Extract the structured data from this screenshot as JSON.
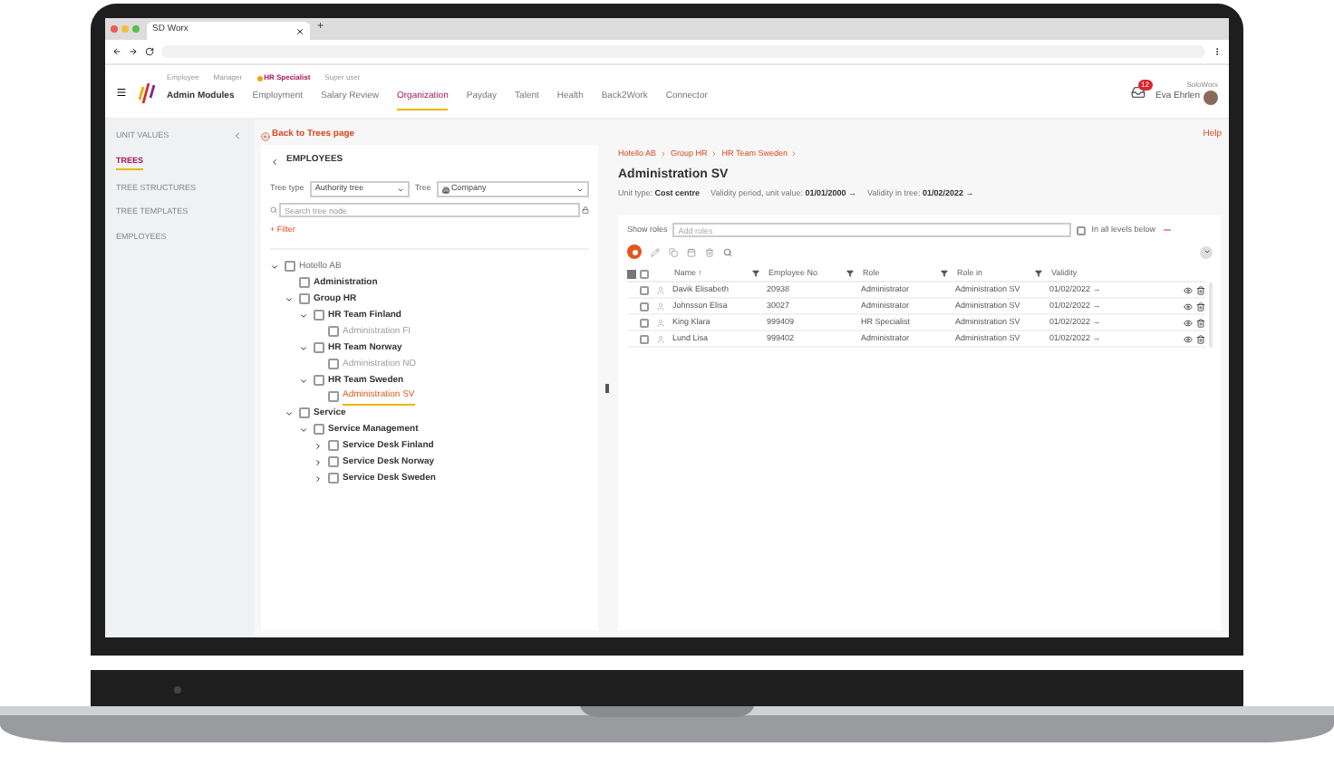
{
  "browser": {
    "tab_title": "SD Worx",
    "new_tab": "+"
  },
  "header": {
    "roles": [
      {
        "label": "Employee",
        "selected": false
      },
      {
        "label": "Manager",
        "selected": false
      },
      {
        "label": "HR Specialist",
        "selected": true
      },
      {
        "label": "Super user",
        "selected": false
      }
    ],
    "nav": [
      {
        "label": "Admin Modules",
        "selected": false,
        "kind": "title"
      },
      {
        "label": "Employment",
        "selected": false,
        "kind": "tab"
      },
      {
        "label": "Salary Review",
        "selected": false,
        "kind": "tab"
      },
      {
        "label": "Organization",
        "selected": true,
        "kind": "tab"
      },
      {
        "label": "Payday",
        "selected": false,
        "kind": "tab"
      },
      {
        "label": "Talent",
        "selected": false,
        "kind": "tab"
      },
      {
        "label": "Health",
        "selected": false,
        "kind": "tab"
      },
      {
        "label": "Back2Work",
        "selected": false,
        "kind": "tab"
      },
      {
        "label": "Connector",
        "selected": false,
        "kind": "tab"
      }
    ],
    "notification_count": "12",
    "company": "SoloWorx",
    "user": "Eva Ehrlen",
    "help": "Help"
  },
  "sidebar": {
    "items": [
      {
        "label": "UNIT VALUES",
        "selected": false
      },
      {
        "label": "TREES",
        "selected": true
      },
      {
        "label": "TREE STRUCTURES",
        "selected": false
      },
      {
        "label": "TREE TEMPLATES",
        "selected": false
      },
      {
        "label": "EMPLOYEES",
        "selected": false
      }
    ]
  },
  "back_link": "Back to Trees page",
  "tree_panel": {
    "title": "EMPLOYEES",
    "tree_type": {
      "label": "Tree type",
      "value": "Authority tree"
    },
    "tree": {
      "label": "Tree",
      "value": "Company"
    },
    "search": {
      "placeholder": "Search tree node"
    },
    "filter": "+ Filter",
    "nodes": [
      {
        "label": "Hotello AB",
        "kind": "root",
        "expanded": true,
        "selected": false,
        "children": [
          {
            "label": "Administration",
            "kind": "group",
            "selected": false
          },
          {
            "label": "Group HR",
            "kind": "group",
            "expanded": true,
            "selected": false,
            "children": [
              {
                "label": "HR Team Finland",
                "kind": "group",
                "expanded": true,
                "selected": false,
                "children": [
                  {
                    "label": "Administration FI",
                    "kind": "unit",
                    "selected": false
                  }
                ]
              },
              {
                "label": "HR Team Norway",
                "kind": "group",
                "expanded": true,
                "selected": false,
                "children": [
                  {
                    "label": "Administration NO",
                    "kind": "unit",
                    "selected": false
                  }
                ]
              },
              {
                "label": "HR Team Sweden",
                "kind": "group",
                "expanded": true,
                "selected": false,
                "children": [
                  {
                    "label": "Administration SV",
                    "kind": "unit",
                    "selected": true
                  }
                ]
              }
            ]
          },
          {
            "label": "Service",
            "kind": "group",
            "expanded": true,
            "selected": false,
            "children": [
              {
                "label": "Service Management",
                "kind": "group",
                "expanded": true,
                "selected": false,
                "children": [
                  {
                    "label": "Service Desk Finland",
                    "kind": "group",
                    "expanded": false,
                    "selected": false
                  },
                  {
                    "label": "Service Desk Norway",
                    "kind": "group",
                    "expanded": false,
                    "selected": false
                  },
                  {
                    "label": "Service Desk Sweden",
                    "kind": "group",
                    "expanded": false,
                    "selected": false
                  }
                ]
              }
            ]
          }
        ]
      }
    ]
  },
  "detail": {
    "breadcrumb": [
      "Hotello AB",
      "Group HR",
      "HR Team Sweden"
    ],
    "title": "Administration SV",
    "meta": [
      {
        "label": "Unit type:",
        "value": "Cost centre"
      },
      {
        "label": "Validity period, unit value:",
        "value": "01/01/2000 →"
      },
      {
        "label": "Validity in tree:",
        "value": "01/02/2022 →"
      }
    ],
    "show_roles": {
      "label": "Show roles",
      "placeholder": "Add roles"
    },
    "all_levels": {
      "label": "In all levels below",
      "checked": false
    },
    "table": {
      "select_all_checked": false,
      "columns": [
        "Name ↑",
        "Employee No",
        "Role",
        "Role in",
        "Validity"
      ],
      "rows": [
        {
          "checked": false,
          "cells": [
            "Davik Elisabeth",
            "20938",
            "Administrator",
            "Administration SV",
            "01/02/2022 →"
          ]
        },
        {
          "checked": false,
          "cells": [
            "Johnsson Elisa",
            "30027",
            "Administrator",
            "Administration SV",
            "01/02/2022 →"
          ]
        },
        {
          "checked": false,
          "cells": [
            "King Klara",
            "999409",
            "HR Specialist",
            "Administration SV",
            "01/02/2022 →"
          ]
        },
        {
          "checked": false,
          "cells": [
            "Lund Lisa",
            "999402",
            "Administrator",
            "Administration SV",
            "01/02/2022 →"
          ]
        }
      ]
    }
  }
}
